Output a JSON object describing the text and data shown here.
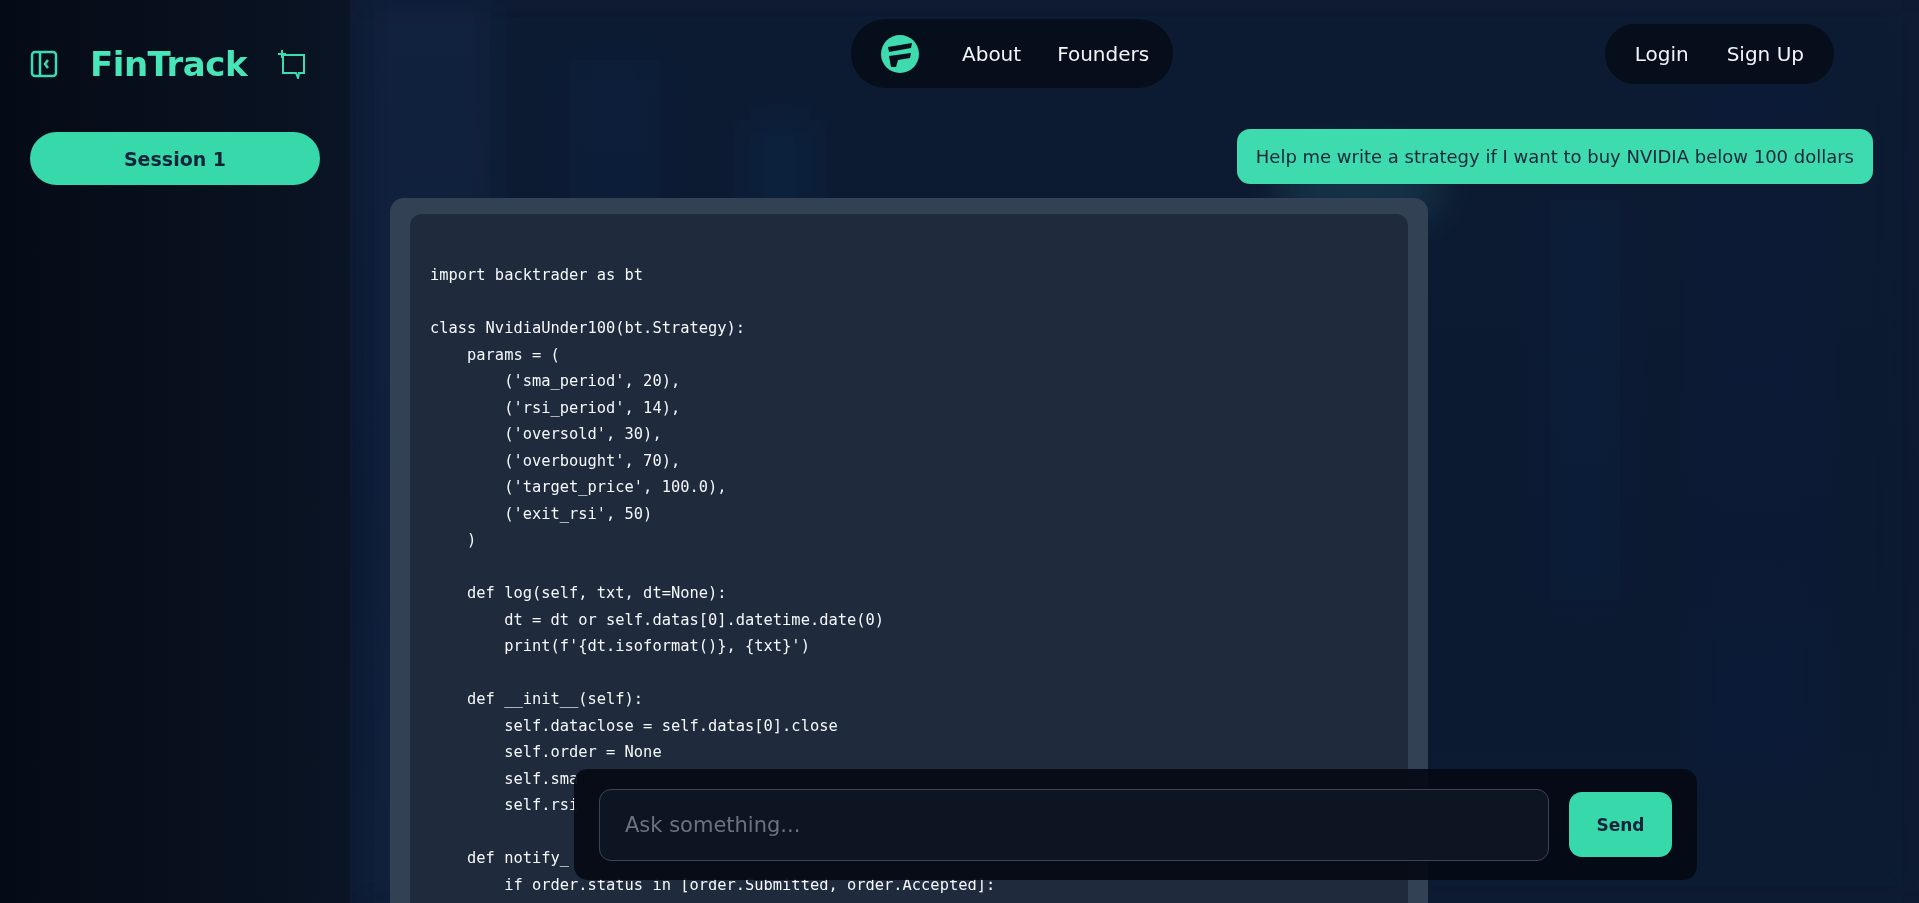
{
  "sidebar": {
    "brand": "FinTrack",
    "sessions": [
      {
        "label": "Session 1",
        "selected": true
      }
    ]
  },
  "nav": {
    "links": [
      "About",
      "Founders"
    ],
    "auth": [
      "Login",
      "Sign Up"
    ]
  },
  "messages": [
    {
      "kind": "text",
      "text": "Help me write a strategy if I want to buy NVIDIA below 100 dollars"
    },
    {
      "kind": "code",
      "blocks": [
        [
          "import backtrader as bt"
        ],
        [
          "class NvidiaUnder100(bt.Strategy):",
          "    params = (",
          "        ('sma_period', 20),",
          "        ('rsi_period', 14),",
          "        ('oversold', 30),",
          "        ('overbought', 70),",
          "        ('target_price', 100.0),",
          "        ('exit_rsi', 50)",
          "    )"
        ],
        [
          "    def log(self, txt, dt=None):",
          "        dt = dt or self.datas[0].datetime.date(0)",
          "        print(f'{dt.isoformat()}, {txt}')"
        ],
        [
          "    def __init__(self):",
          "        self.dataclose = self.datas[0].close",
          "        self.order = None",
          "        self.sma",
          "        self.rsi"
        ],
        [
          "    def notify_",
          "        if order.status in [order.Submitted, order.Accepted]:"
        ]
      ]
    }
  ],
  "composer": {
    "placeholder": "Ask something...",
    "button": "Send"
  }
}
